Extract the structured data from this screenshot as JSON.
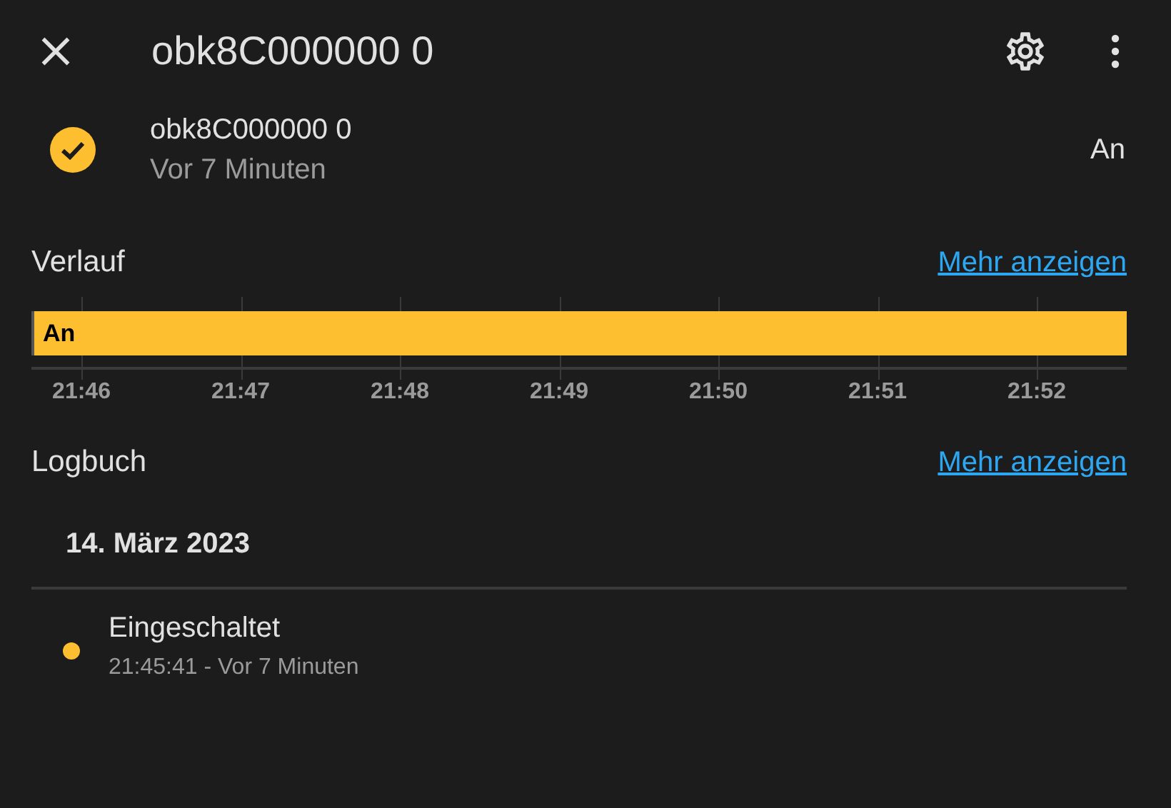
{
  "header": {
    "title": "obk8C000000 0"
  },
  "entity": {
    "name": "obk8C000000 0",
    "changed": "Vor 7 Minuten",
    "state": "An"
  },
  "history": {
    "title": "Verlauf",
    "more_link": "Mehr anzeigen",
    "bar": {
      "label": "An",
      "color": "#fdbf2f"
    },
    "ticks": [
      "21:46",
      "21:47",
      "21:48",
      "21:49",
      "21:50",
      "21:51",
      "21:52"
    ]
  },
  "logbook": {
    "title": "Logbuch",
    "more_link": "Mehr anzeigen",
    "date": "14. März 2023",
    "entries": [
      {
        "message": "Eingeschaltet",
        "time": "21:45:41 - Vor 7 Minuten",
        "color": "#fdbf2f"
      }
    ]
  }
}
